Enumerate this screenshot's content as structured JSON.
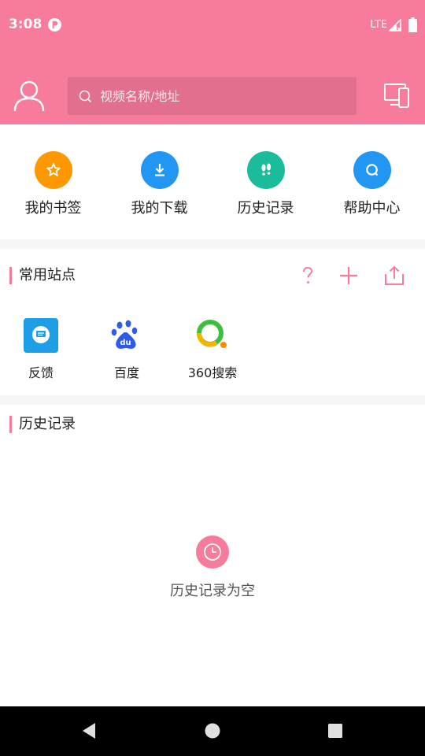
{
  "status_bar": {
    "time": "3:08",
    "network": "LTE"
  },
  "header": {
    "search_placeholder": "视频名称/地址",
    "accent_color": "#f77b9b"
  },
  "quick_actions": [
    {
      "label": "我的书签",
      "icon": "bookmark-star-icon",
      "color": "#ff9800"
    },
    {
      "label": "我的下载",
      "icon": "download-icon",
      "color": "#2196f3"
    },
    {
      "label": "历史记录",
      "icon": "footprints-icon",
      "color": "#1bbc9b"
    },
    {
      "label": "帮助中心",
      "icon": "help-search-icon",
      "color": "#2196f3"
    }
  ],
  "sites_section": {
    "title": "常用站点",
    "items": [
      {
        "name": "反馈",
        "icon": "feedback-icon"
      },
      {
        "name": "百度",
        "icon": "baidu-icon"
      },
      {
        "name": "360搜索",
        "icon": "360-search-icon"
      }
    ]
  },
  "history_section": {
    "title": "历史记录",
    "empty_text": "历史记录为空"
  }
}
